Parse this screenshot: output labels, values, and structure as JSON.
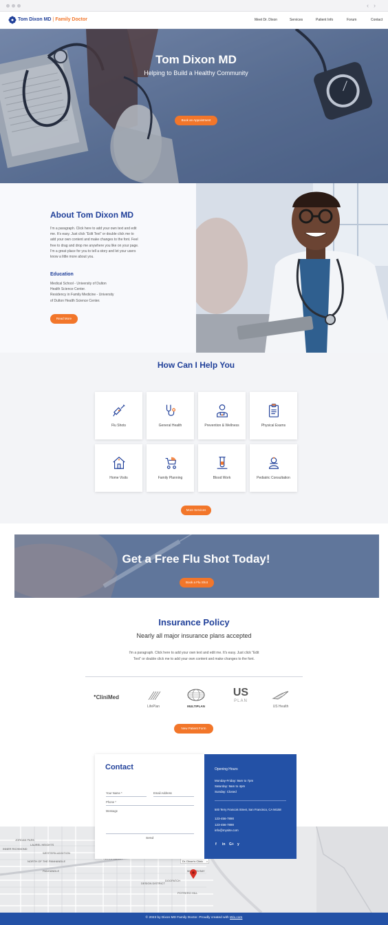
{
  "header": {
    "brand_name": "Tom Dixon MD",
    "brand_sep": "|",
    "brand_sub": "Family Doctor",
    "nav": [
      "Meet Dr. Dixon",
      "Services",
      "Patient Info",
      "Forum",
      "Contact"
    ]
  },
  "hero": {
    "title": "Tom Dixon MD",
    "subtitle": "Helping to Build a Healthy Community",
    "cta": "Book an Appointment"
  },
  "about": {
    "title": "About Tom Dixon MD",
    "paragraph_lines": [
      "I'm a paragraph. Click here to add your own text and edit",
      "me. It's easy. Just click “Edit Text” or double click me to",
      "add your own content and make changes to the font. Feel",
      "free to drag and drop me anywhere you like on your page.",
      "I'm a great place for you to tell a story and let your users",
      "know a little more about you."
    ],
    "education_title": "Education",
    "education_lines": [
      "Medical School - University of Dulton",
      "Health Science Center.",
      "Residency in Family Medicine - University",
      "of Dulton Health Science Center."
    ],
    "cta": "Read More"
  },
  "services": {
    "title": "How Can I Help You",
    "items": [
      {
        "label": "Flu Shots",
        "icon": "syringe-icon"
      },
      {
        "label": "General Health",
        "icon": "stethoscope-icon"
      },
      {
        "label": "Prevention & Wellness",
        "icon": "doctor-icon"
      },
      {
        "label": "Physical Exams",
        "icon": "clipboard-icon"
      },
      {
        "label": "Home Visits",
        "icon": "house-icon"
      },
      {
        "label": "Family Planning",
        "icon": "stroller-icon"
      },
      {
        "label": "Blood Work",
        "icon": "test-tube-icon"
      },
      {
        "label": "Pediatric Consultation",
        "icon": "baby-icon"
      }
    ],
    "cta": "More Services"
  },
  "flu": {
    "title": "Get a Free Flu Shot Today!",
    "cta": "Book a Flu Shot"
  },
  "insurance": {
    "title": "Insurance Policy",
    "subtitle": "Nearly all major insurance plans accepted",
    "paragraph_lines": [
      "I'm a paragraph. Click here to add your own text and edit me. It's easy. Just click “Edit",
      "Text” or double click me to add your own content and make changes to the font."
    ],
    "logos": {
      "clinimed": "CliniMed",
      "lifeplan": "LifePlan",
      "multiplan": "MULTIPLAN",
      "usplan_top": "US",
      "usplan_bottom": "PLAN",
      "ushealth": "US Health"
    },
    "cta": "New Patient Form"
  },
  "contact": {
    "title": "Contact",
    "name_label": "Your Name *",
    "email_label": "Email Address",
    "phone_label": "Phone *",
    "message_label": "Message",
    "send": "Send",
    "hours_title": "Opening Hours",
    "hours": [
      "Monday-Friday: 9am to 7pm",
      "Saturday: 9am to 4pm",
      "Sunday: Closed"
    ],
    "address": "500 Terry Francois Street, San Francisco, CA 94158",
    "phone1": "123-456-7890",
    "phone2": "123-456-7890",
    "email": "info@mysite.com",
    "social": [
      "f",
      "in",
      "G+",
      "y"
    ]
  },
  "map": {
    "pin_label": "Dr. Dixon's Clinic",
    "labels": [
      "JORDAN PARK",
      "LAUREL HEIGHTS",
      "INNER RICHMOND",
      "WESTERN ADDITION",
      "NORTH OF THE PANHANDLE",
      "PANHANDLE",
      "HAYES VALLEY",
      "DOGPATCH",
      "DESIGN DISTRICT",
      "MISSION BAY",
      "POTRERO HILL"
    ]
  },
  "footer": {
    "text": "© 2023 by Dixon MD Family Doctor. Proudly created with ",
    "link": "Wix.com"
  },
  "colors": {
    "brand_blue": "#1f3f99",
    "accent_orange": "#f2762a",
    "footer_blue": "#2351a6"
  }
}
